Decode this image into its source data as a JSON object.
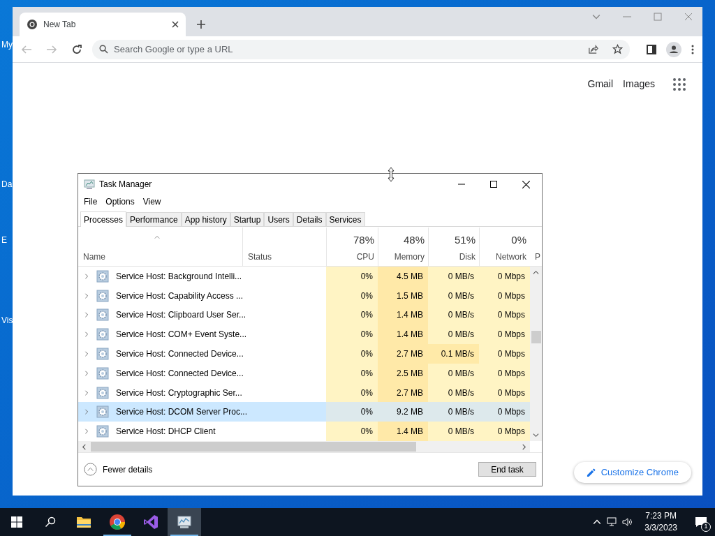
{
  "desktop_icons": [
    {
      "label": "My"
    },
    {
      "label": "Da"
    },
    {
      "label": "E"
    },
    {
      "label": "Vis"
    }
  ],
  "browser": {
    "tab": {
      "title": "New Tab"
    },
    "address_bar": {
      "placeholder": "Search Google or type a URL"
    },
    "links": [
      "Gmail",
      "Images"
    ],
    "customize_button": "Customize Chrome"
  },
  "task_manager": {
    "title": "Task Manager",
    "menu": [
      "File",
      "Options",
      "View"
    ],
    "tabs": [
      {
        "label": "Processes",
        "selected": true
      },
      {
        "label": "Performance",
        "selected": false
      },
      {
        "label": "App history",
        "selected": false
      },
      {
        "label": "Startup",
        "selected": false
      },
      {
        "label": "Users",
        "selected": false
      },
      {
        "label": "Details",
        "selected": false
      },
      {
        "label": "Services",
        "selected": false
      }
    ],
    "columns": [
      {
        "label": "Name"
      },
      {
        "label": "Status"
      },
      {
        "label": "CPU",
        "percent": "78%"
      },
      {
        "label": "Memory",
        "percent": "48%"
      },
      {
        "label": "Disk",
        "percent": "51%"
      },
      {
        "label": "Network",
        "percent": "0%"
      },
      {
        "label": "P"
      }
    ],
    "rows": [
      {
        "name": "Service Host: Background Intelli...",
        "cpu": "0%",
        "memory": "4.5 MB",
        "disk": "0 MB/s",
        "network": "0 Mbps",
        "disk_busy": false,
        "selected": false
      },
      {
        "name": "Service Host: Capability Access ...",
        "cpu": "0%",
        "memory": "1.5 MB",
        "disk": "0 MB/s",
        "network": "0 Mbps",
        "disk_busy": false,
        "selected": false
      },
      {
        "name": "Service Host: Clipboard User Ser...",
        "cpu": "0%",
        "memory": "1.4 MB",
        "disk": "0 MB/s",
        "network": "0 Mbps",
        "disk_busy": false,
        "selected": false
      },
      {
        "name": "Service Host: COM+ Event Syste...",
        "cpu": "0%",
        "memory": "1.4 MB",
        "disk": "0 MB/s",
        "network": "0 Mbps",
        "disk_busy": false,
        "selected": false
      },
      {
        "name": "Service Host: Connected Device...",
        "cpu": "0%",
        "memory": "2.7 MB",
        "disk": "0.1 MB/s",
        "network": "0 Mbps",
        "disk_busy": true,
        "selected": false
      },
      {
        "name": "Service Host: Connected Device...",
        "cpu": "0%",
        "memory": "2.5 MB",
        "disk": "0 MB/s",
        "network": "0 Mbps",
        "disk_busy": false,
        "selected": false
      },
      {
        "name": "Service Host: Cryptographic Ser...",
        "cpu": "0%",
        "memory": "2.7 MB",
        "disk": "0 MB/s",
        "network": "0 Mbps",
        "disk_busy": false,
        "selected": false
      },
      {
        "name": "Service Host: DCOM Server Proc...",
        "cpu": "0%",
        "memory": "9.2 MB",
        "disk": "0 MB/s",
        "network": "0 Mbps",
        "disk_busy": false,
        "selected": true
      },
      {
        "name": "Service Host: DHCP Client",
        "cpu": "0%",
        "memory": "1.4 MB",
        "disk": "0 MB/s",
        "network": "0 Mbps",
        "disk_busy": false,
        "selected": false
      }
    ],
    "fewer_details": "Fewer details",
    "end_task": "End task"
  },
  "taskbar": {
    "apps": [
      {
        "kind": "explorer",
        "running": false,
        "selected": false
      },
      {
        "kind": "chrome",
        "running": true,
        "selected": false
      },
      {
        "kind": "studio",
        "running": false,
        "selected": false
      },
      {
        "kind": "taskmgr",
        "running": true,
        "selected": true
      }
    ],
    "time": "7:23 PM",
    "date": "3/3/2023",
    "notifications": "1"
  }
}
